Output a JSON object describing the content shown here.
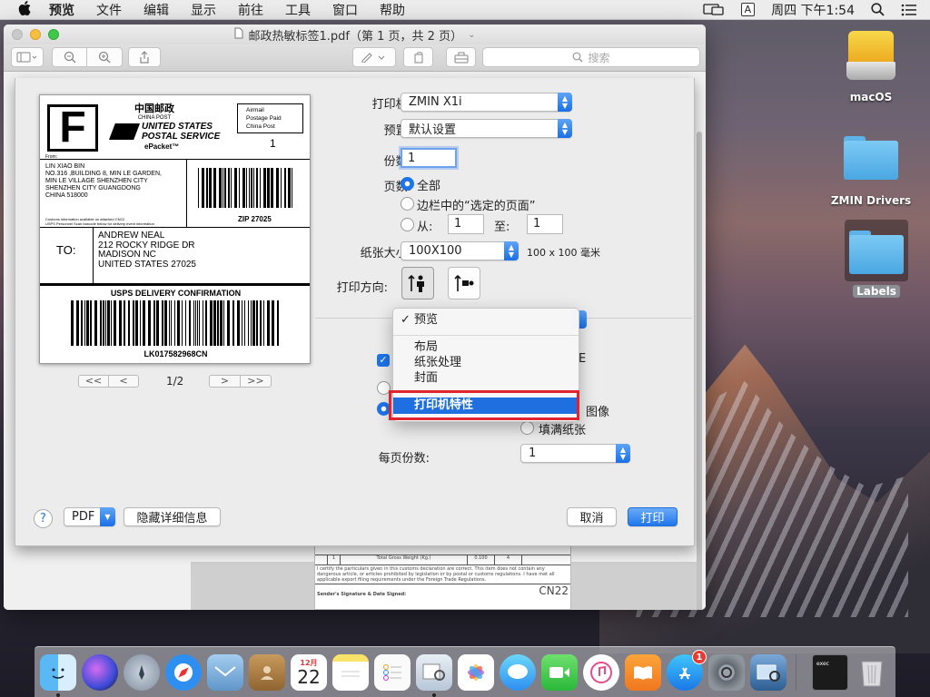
{
  "menubar": {
    "items": [
      "预览",
      "文件",
      "编辑",
      "显示",
      "前往",
      "工具",
      "窗口",
      "帮助"
    ],
    "ime": "A",
    "clock": "周四 下午1:54"
  },
  "window": {
    "title": "邮政热敏标签1.pdf（第 1 页，共 2 页）",
    "search_placeholder": "搜索"
  },
  "label": {
    "letter": "F",
    "china_post_cn": "中国邮政",
    "china_post_en": "CHINA POST",
    "usps_line1": "UNITED STATES",
    "usps_line2": "POSTAL SERVICE",
    "epacket": "ePacket™",
    "airmail_lines": [
      "Airmail",
      "Postage Paid",
      "China Post"
    ],
    "count": "1",
    "from_label": "From:",
    "from_lines": [
      "LIN XIAO BIN",
      "NO.316 ,BUILDING 8, MIN LE GARDEN,",
      "MIN LE VILLAGE SHENZHEN CITY",
      "SHENZHEN CITY GUANGDONG",
      "CHINA 518000"
    ],
    "customs_note": "Customs information available on attached CN22.",
    "customs_note2": "USPS Personnel Scan barcode below for delivery event information",
    "zip": "ZIP 27025",
    "to_label": "TO:",
    "to_lines": [
      "ANDREW NEAL",
      "212 ROCKY RIDGE DR",
      "MADISON NC",
      "UNITED STATES 27025"
    ],
    "confirmation": "USPS DELIVERY CONFIRMATION",
    "tracking": "LK017582968CN"
  },
  "pager": {
    "prev": [
      "<<",
      "<"
    ],
    "next": [
      ">",
      ">>"
    ],
    "page_indicator": "1/2"
  },
  "print": {
    "printer_label": "打印机:",
    "printer_value": "ZMIN X1i",
    "preset_label": "预置:",
    "preset_value": "默认设置",
    "copies_label": "份数:",
    "copies_value": "1",
    "pages_label": "页数:",
    "pages_all": "全部",
    "pages_selected": "边栏中的“选定的页面”",
    "pages_from": "从:",
    "from_value": "1",
    "to_label": "至:",
    "to_value": "1",
    "paper_label": "纸张大小:",
    "paper_value": "100X100",
    "paper_dims": "100 x 100 毫米",
    "orientation_label": "打印方向:",
    "partial_right_1": "E",
    "scale_image": "图像",
    "fill_paper": "填满纸张",
    "per_page_label": "每页份数:",
    "per_page_value": "1",
    "help": "?",
    "pdf_button": "PDF",
    "hide_details": "隐藏详细信息",
    "cancel": "取消",
    "print": "打印"
  },
  "dropdown": {
    "items": [
      {
        "label": "预览",
        "checked": true
      },
      {
        "label": "布局",
        "checked": false
      },
      {
        "label": "纸张处理",
        "checked": false
      },
      {
        "label": "封面",
        "checked": false
      },
      {
        "label": "打印机特性",
        "checked": false,
        "selected": true
      }
    ]
  },
  "bg_doc": {
    "row_num": "1",
    "gross_weight": "Total Gross Weight (Kg.)",
    "weight_value": "0.100",
    "weight_count": "4",
    "declaration": "I certify the particulars given in this customs declaration are correct. This item does not contain any dangerous article, or articles prohibited by legislation or by postal or customs regulations. I have met all applicable export filing requirements under the Foreign Trade Regulations.",
    "signature": "Sender's Signature & Date Signed:",
    "form_code": "CN22"
  },
  "desktop": {
    "icons": [
      "macOS",
      "ZMIN Drivers",
      "Labels"
    ]
  },
  "dock": {
    "calendar_month": "12月",
    "calendar_day": "22",
    "appstore_badge": "1",
    "terminal_text": "exec"
  }
}
